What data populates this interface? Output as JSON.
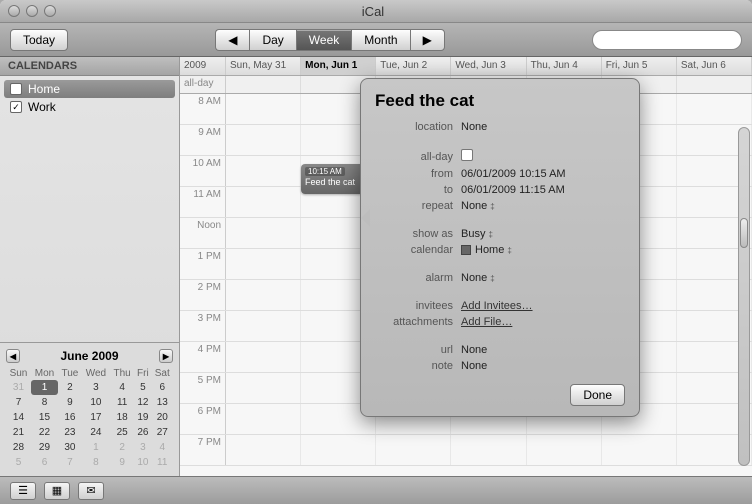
{
  "window": {
    "title": "iCal"
  },
  "toolbar": {
    "today": "Today",
    "views": {
      "day": "Day",
      "week": "Week",
      "month": "Month",
      "active": "Week"
    },
    "search_placeholder": ""
  },
  "sidebar": {
    "header": "CALENDARS",
    "items": [
      {
        "label": "Home",
        "checked": true,
        "selected": true
      },
      {
        "label": "Work",
        "checked": true,
        "selected": false
      }
    ]
  },
  "mini_calendar": {
    "title": "June 2009",
    "dow": [
      "Sun",
      "Mon",
      "Tue",
      "Wed",
      "Thu",
      "Fri",
      "Sat"
    ],
    "weeks": [
      [
        {
          "n": 31,
          "dim": true
        },
        {
          "n": 1,
          "today": true
        },
        {
          "n": 2
        },
        {
          "n": 3
        },
        {
          "n": 4
        },
        {
          "n": 5
        },
        {
          "n": 6
        }
      ],
      [
        {
          "n": 7
        },
        {
          "n": 8
        },
        {
          "n": 9
        },
        {
          "n": 10
        },
        {
          "n": 11
        },
        {
          "n": 12
        },
        {
          "n": 13
        }
      ],
      [
        {
          "n": 14
        },
        {
          "n": 15
        },
        {
          "n": 16
        },
        {
          "n": 17
        },
        {
          "n": 18
        },
        {
          "n": 19
        },
        {
          "n": 20
        }
      ],
      [
        {
          "n": 21
        },
        {
          "n": 22
        },
        {
          "n": 23
        },
        {
          "n": 24
        },
        {
          "n": 25
        },
        {
          "n": 26
        },
        {
          "n": 27
        }
      ],
      [
        {
          "n": 28
        },
        {
          "n": 29
        },
        {
          "n": 30
        },
        {
          "n": 1,
          "dim": true
        },
        {
          "n": 2,
          "dim": true
        },
        {
          "n": 3,
          "dim": true
        },
        {
          "n": 4,
          "dim": true
        }
      ],
      [
        {
          "n": 5,
          "dim": true
        },
        {
          "n": 6,
          "dim": true
        },
        {
          "n": 7,
          "dim": true
        },
        {
          "n": 8,
          "dim": true
        },
        {
          "n": 9,
          "dim": true
        },
        {
          "n": 10,
          "dim": true
        },
        {
          "n": 11,
          "dim": true
        }
      ]
    ]
  },
  "grid": {
    "year": "2009",
    "days": [
      "Sun, May 31",
      "Mon, Jun 1",
      "Tue, Jun 2",
      "Wed, Jun 3",
      "Thu, Jun 4",
      "Fri, Jun 5",
      "Sat, Jun 6"
    ],
    "today_index": 1,
    "allday_label": "all-day",
    "hours": [
      "8 AM",
      "9 AM",
      "10 AM",
      "11 AM",
      "Noon",
      "1 PM",
      "2 PM",
      "3 PM",
      "4 PM",
      "5 PM",
      "6 PM",
      "7 PM"
    ],
    "event": {
      "time": "10:15 AM",
      "title": "Feed the cat"
    }
  },
  "popover": {
    "title": "Feed the cat",
    "rows": {
      "location_k": "location",
      "location_v": "None",
      "allday_k": "all-day",
      "from_k": "from",
      "from_v": "06/01/2009 10:15 AM",
      "to_k": "to",
      "to_v": "06/01/2009 11:15 AM",
      "repeat_k": "repeat",
      "repeat_v": "None",
      "showas_k": "show as",
      "showas_v": "Busy",
      "calendar_k": "calendar",
      "calendar_v": "Home",
      "alarm_k": "alarm",
      "alarm_v": "None",
      "invitees_k": "invitees",
      "invitees_v": "Add Invitees…",
      "attach_k": "attachments",
      "attach_v": "Add File…",
      "url_k": "url",
      "url_v": "None",
      "note_k": "note",
      "note_v": "None"
    },
    "done": "Done"
  }
}
